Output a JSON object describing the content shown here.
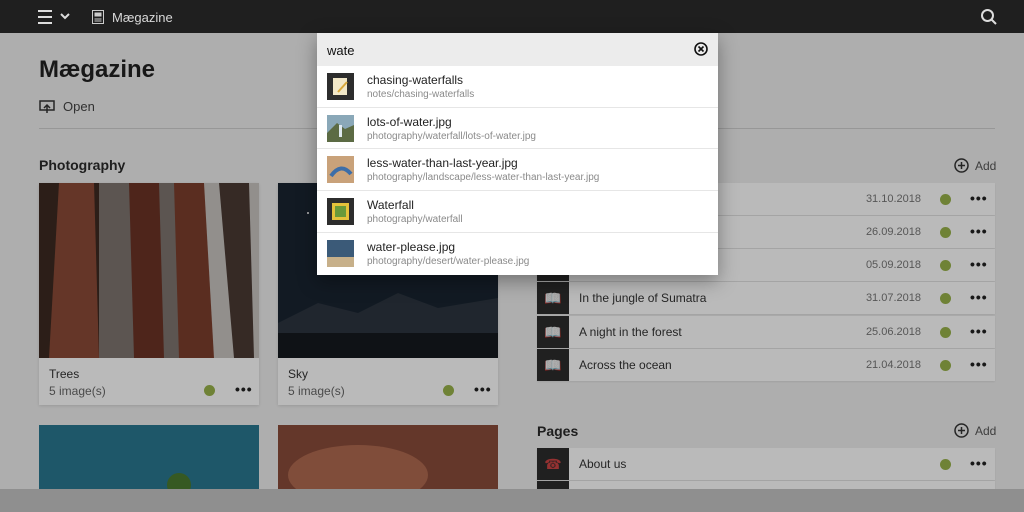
{
  "app": {
    "title": "Mægazine"
  },
  "icons": {
    "menu": "hamburger-icon",
    "chevron": "chevron-down-icon",
    "magazine": "magazine-icon",
    "search": "search-icon",
    "open": "open-icon",
    "add": "add-circle-icon",
    "clear": "clear-icon",
    "book": "book-icon",
    "phone": "phone-icon"
  },
  "colors": {
    "topbar": "#1f1f1f",
    "status_dot": "#99b34a"
  },
  "page": {
    "title": "Mægazine",
    "open_label": "Open"
  },
  "photography": {
    "title": "Photography",
    "cards": [
      {
        "name": "Trees",
        "count": "5 image(s)"
      },
      {
        "name": "Sky",
        "count": "5 image(s)"
      }
    ]
  },
  "articles": {
    "add_label": "Add",
    "items": [
      {
        "title": "",
        "date": "31.10.2018"
      },
      {
        "title": "",
        "date": "26.09.2018"
      },
      {
        "title": "",
        "date": "05.09.2018"
      },
      {
        "title": "In the jungle of Sumatra",
        "date": "31.07.2018"
      },
      {
        "title": "A night in the forest",
        "date": "25.06.2018"
      },
      {
        "title": "Across the ocean",
        "date": "21.04.2018"
      }
    ]
  },
  "pages": {
    "title": "Pages",
    "add_label": "Add",
    "items": [
      {
        "title": "About us"
      }
    ]
  },
  "search": {
    "query": "wate",
    "results": [
      {
        "title": "chasing-waterfalls",
        "path": "notes/chasing-waterfalls"
      },
      {
        "title": "lots-of-water.jpg",
        "path": "photography/waterfall/lots-of-water.jpg"
      },
      {
        "title": "less-water-than-last-year.jpg",
        "path": "photography/landscape/less-water-than-last-year.jpg"
      },
      {
        "title": "Waterfall",
        "path": "photography/waterfall"
      },
      {
        "title": "water-please.jpg",
        "path": "photography/desert/water-please.jpg"
      }
    ]
  }
}
